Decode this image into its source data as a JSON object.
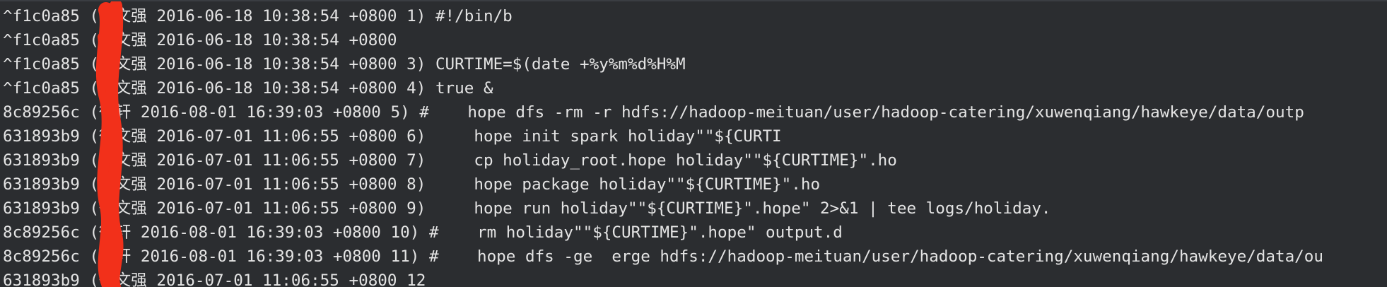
{
  "lines": [
    {
      "hash": "^f1c0a85",
      "author": "(徐文强",
      "datetime": "2016-06-18 10:38:54 +0800",
      "lineno": "1)",
      "code": "#!/bin/b"
    },
    {
      "hash": "^f1c0a85",
      "author": "(徐文强",
      "datetime": "2016-06-18 10:38:54 +0800",
      "lineno": "",
      "code": ""
    },
    {
      "hash": "^f1c0a85",
      "author": "(徐文强",
      "datetime": "2016-06-18 10:38:54 +0800",
      "lineno": "3)",
      "code": "CURTIME=$(date +%y%m%d%H%M"
    },
    {
      "hash": "^f1c0a85",
      "author": "(徐文强",
      "datetime": "2016-06-18 10:38:54 +0800",
      "lineno": "4)",
      "code": "true &"
    },
    {
      "hash": "8c89256c",
      "author": "(徐轩",
      "datetime": "2016-08-01 16:39:03 +0800",
      "lineno": "5)",
      "code": "#    hope dfs -rm -r hdfs://hadoop-meituan/user/hadoop-catering/xuwenqiang/hawkeye/data/outp"
    },
    {
      "hash": "631893b9",
      "author": "(徐文强",
      "datetime": "2016-07-01 11:06:55 +0800",
      "lineno": "6)",
      "code": "    hope init spark holiday\"\"${CURTI"
    },
    {
      "hash": "631893b9",
      "author": "(徐文强",
      "datetime": "2016-07-01 11:06:55 +0800",
      "lineno": "7)",
      "code": "    cp holiday_root.hope holiday\"\"${CURTIME}\".ho"
    },
    {
      "hash": "631893b9",
      "author": "(徐文强",
      "datetime": "2016-07-01 11:06:55 +0800",
      "lineno": "8)",
      "code": "    hope package holiday\"\"${CURTIME}\".ho"
    },
    {
      "hash": "631893b9",
      "author": "(徐文强",
      "datetime": "2016-07-01 11:06:55 +0800",
      "lineno": "9)",
      "code": "    hope run holiday\"\"${CURTIME}\".hope\" 2>&1 | tee logs/holiday."
    },
    {
      "hash": "8c89256c",
      "author": "(徐轩",
      "datetime": "2016-08-01 16:39:03 +0800",
      "lineno": "10)",
      "code": "#    rm holiday\"\"${CURTIME}\".hope\" output.d"
    },
    {
      "hash": "8c89256c",
      "author": "(徐轩",
      "datetime": "2016-08-01 16:39:03 +0800",
      "lineno": "11)",
      "code": "#    hope dfs -ge  erge hdfs://hadoop-meituan/user/hadoop-catering/xuwenqiang/hawkeye/data/ou"
    },
    {
      "hash": "631893b9",
      "author": "(徐文强",
      "datetime": "2016-07-01 11:06:55 +0800",
      "lineno": "12",
      "code": ""
    }
  ],
  "colors": {
    "background": "#2b2d30",
    "text": "#e4e4e4",
    "redaction": "#f2301a"
  }
}
